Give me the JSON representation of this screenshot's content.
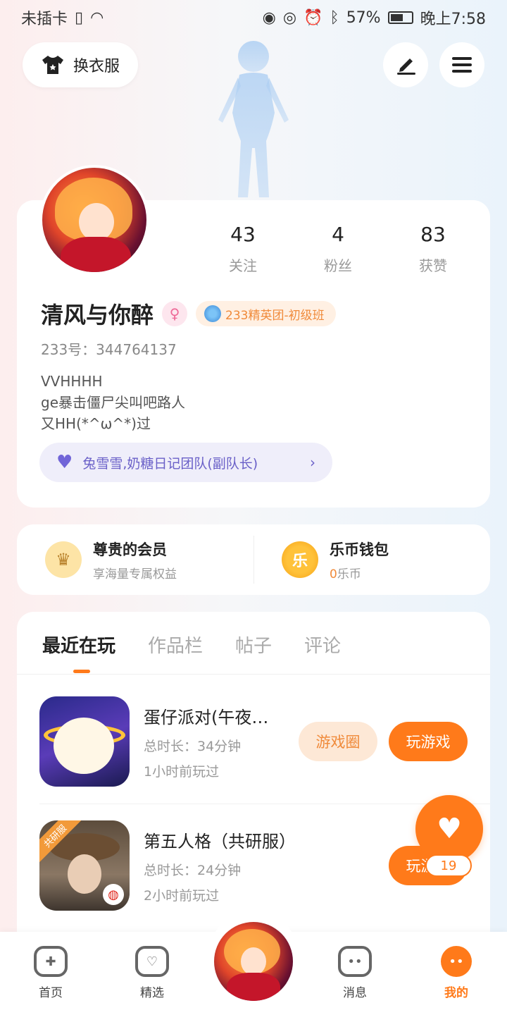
{
  "status_bar": {
    "carrier": "未插卡",
    "battery": "57%",
    "time": "晚上7:58"
  },
  "top": {
    "outfit_label": "换衣服",
    "edit_icon": "edit-icon",
    "menu_icon": "menu-icon"
  },
  "profile": {
    "stats": [
      {
        "num": "43",
        "label": "关注"
      },
      {
        "num": "4",
        "label": "粉丝"
      },
      {
        "num": "83",
        "label": "获赞"
      }
    ],
    "username": "清风与你醉",
    "gender_symbol": "♀",
    "badge": "233精英团-初级班",
    "uid": "233号：344764137",
    "bio_lines": [
      "VVHHHH",
      "ge暴击僵尸尖叫吧路人",
      "又HH(*^ω^*)过"
    ],
    "team": "兔雪雪,奶糖日记团队(副队长)"
  },
  "member": {
    "vip_title": "尊贵的会员",
    "vip_sub": "享海量专属权益",
    "wallet_title": "乐币钱包",
    "wallet_amount": "0",
    "wallet_unit": "乐币",
    "coin_char": "乐"
  },
  "tabs": [
    "最近在玩",
    "作品栏",
    "帖子",
    "评论"
  ],
  "games": [
    {
      "name": "蛋仔派对(午夜…",
      "time": "总时长：34分钟",
      "last": "1小时前玩过",
      "circle_label": "游戏圈",
      "play_label": "玩游戏"
    },
    {
      "name": "第五人格（共研服）",
      "time": "总时长：24分钟",
      "last": "2小时前玩过",
      "tag": "共研服",
      "play_label": "玩游戏"
    }
  ],
  "like_count": "19",
  "nav": {
    "home": "首页",
    "featured": "精选",
    "messages": "消息",
    "mine": "我的"
  },
  "colors": {
    "accent": "#ff7a1a",
    "team": "#6a60c8"
  }
}
